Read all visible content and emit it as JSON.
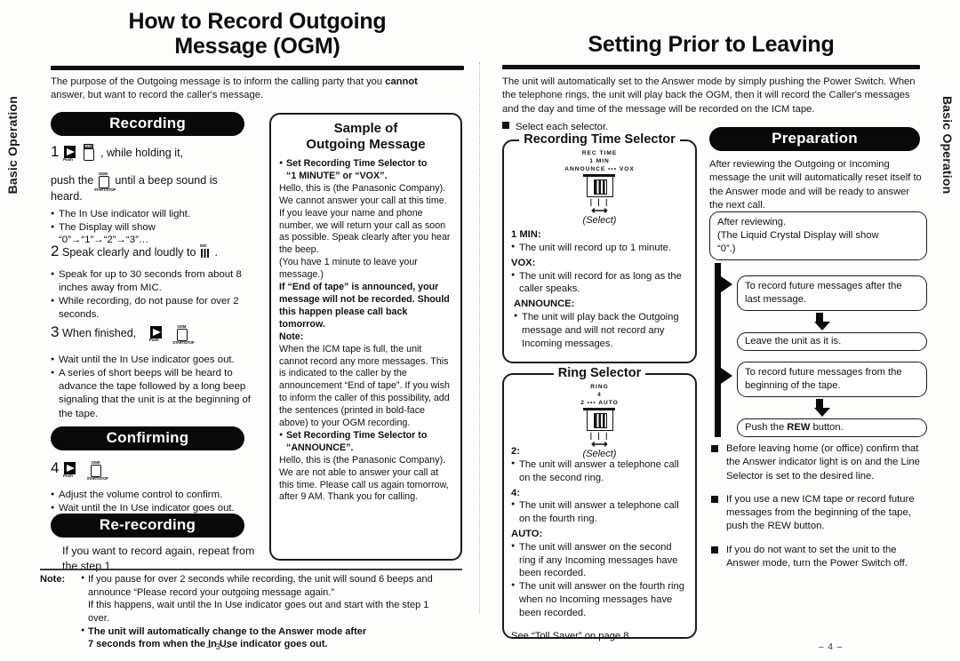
{
  "sidetabs": {
    "left": "Basic Operation",
    "right": "Basic Operation"
  },
  "left_page": {
    "title_line1": "How to Record Outgoing",
    "title_line2": "Message (OGM)",
    "intro_a": "The purpose of the Outgoing message is to inform the calling party that you ",
    "intro_b": "cannot",
    "intro_c": "answer, but want to record the caller's message.",
    "section_recording": "Recording",
    "section_confirming": "Confirming",
    "section_rerecording": "Re-recording",
    "step1": {
      "num": "1",
      "icon_push": "Push",
      "icon_rec": "REC",
      "text_a": ", while holding it,",
      "text_b": "push the",
      "icon_ogm": "OGM",
      "icon_startstop": "START/STOP",
      "text_c": "until a beep sound is",
      "text_d": "heard.",
      "bullets": [
        "The In Use indicator will light.",
        "The Display will show",
        "“0”→“1”→“2”→“3”…"
      ]
    },
    "step2": {
      "num": "2",
      "text_a": "Speak clearly and loudly to",
      "icon_mic": "MIC",
      "text_b": ".",
      "bullets": [
        "Speak for up to 30 seconds from about 8 inches away from MIC.",
        "While recording, do not pause for over 2 seconds."
      ]
    },
    "step3": {
      "num": "3",
      "text_a": "When finished,",
      "icon_push": "Push",
      "icon_ogm": "OGM",
      "icon_startstop": "START/STOP",
      "bullets": [
        "Wait until the In Use indicator goes out.",
        "A series of short beeps will be heard to advance the tape followed by a long beep signaling that the unit is at the beginning of the tape."
      ]
    },
    "step4": {
      "num": "4",
      "icon_push": "Push",
      "icon_ogm": "OGM",
      "icon_startstop": "START/STOP",
      "bullets": [
        "Adjust the volume control to confirm.",
        "Wait until the In Use indicator goes out."
      ]
    },
    "rerecording_text": "If you want to record again, repeat from the step 1.",
    "note": {
      "label": "Note:",
      "item1_line1": "If you pause for over 2 seconds while recording, the unit will sound 6 beeps and",
      "item1_line2": "announce “Please record your outgoing message again.”",
      "item1_line3": "If this happens, wait until the In Use indicator goes out and start with the step 1",
      "item1_line4": "over.",
      "item2_line1": "The unit will automatically change to the Answer mode after",
      "item2_line2": "7 seconds from when the In Use indicator goes out."
    },
    "page_number": "– 3 –",
    "sample_box": {
      "title_line1": "Sample of",
      "title_line2": "Outgoing Message",
      "b1_head_line1": "Set Recording Time Selector to",
      "b1_head_line2": "“1 MINUTE” or “VOX”.",
      "b1_body": "Hello, this is (the Panasonic Company). We cannot answer your call at this time. If you leave your name and phone number, we will return your call as soon as possible. Speak clearly after you hear the beep.",
      "b1_paren": "(You have 1 minute to leave your message.)",
      "b1_bold": "If “End of tape” is announced, your message will not be recorded. Should this happen please call back tomorrow.",
      "note_label": "Note:",
      "note_body": "When the ICM tape is full, the unit cannot record any more messages. This is indicated to the caller by the announcement “End of tape”. If you wish to inform the caller of this possibility, add the sentences (printed in bold-face above) to your OGM recording.",
      "b2_head_line1": "Set Recording Time Selector to",
      "b2_head_line2": "“ANNOUNCE”.",
      "b2_body": "Hello, this is (the Panasonic Company). We are not able to answer your call at this time. Please call us again tomorrow, after 9 AM. Thank you for calling."
    }
  },
  "right_page": {
    "title": "Setting Prior to Leaving",
    "intro": "The unit will automatically set to the Answer mode by simply pushing the Power Switch. When the telephone rings, the unit will play back the OGM, then it will record the Caller's messages and the day and time of the message will be recorded on the ICM tape.",
    "select_label": "Select each selector.",
    "rec_time_selector": {
      "title": "Recording Time Selector",
      "switch_line1": "REC TIME",
      "switch_line2": "1 MIN",
      "switch_line3": "ANNOUNCE ••• VOX",
      "switch_ticks": "❘❘❘",
      "select_caption": "(Select)",
      "entries": [
        {
          "head": "1 MIN:",
          "bullets": [
            "The unit will record up to 1 minute."
          ]
        },
        {
          "head": "VOX:",
          "bullets": [
            "The unit will record for as long as the caller speaks."
          ]
        },
        {
          "head": "ANNOUNCE:",
          "bullets": [
            "The unit will play back the Outgoing message and will not record any Incoming messages."
          ]
        }
      ]
    },
    "ring_selector": {
      "title": "Ring Selector",
      "switch_line1": "RING",
      "switch_line2": "4",
      "switch_line3": "2 ••• AUTO",
      "switch_ticks": "❘❘❘",
      "select_caption": "(Select)",
      "entries": [
        {
          "head": "2:",
          "bullets": [
            "The unit will answer a telephone call on the second ring."
          ]
        },
        {
          "head": "4:",
          "bullets": [
            "The unit will answer a telephone call on the fourth ring."
          ]
        },
        {
          "head": "AUTO:",
          "bullets": [
            "The unit will answer on the second ring if any Incoming messages have been recorded.",
            "The unit will answer on the fourth ring when no Incoming messages have been recorded."
          ]
        }
      ],
      "footer": "See “Toll Saver” on page  8."
    },
    "preparation": {
      "title": "Preparation",
      "intro": "After reviewing the Outgoing or Incoming message the unit will automatically reset itself to the Answer mode and will be ready to answer the next call.",
      "flow": {
        "box1_line1": "After reviewing.",
        "box1_line2": "(The Liquid Crystal Display will show",
        "box1_line3": "“0”.)",
        "box2": "To record future messages after the last message.",
        "box3": "Leave the unit as it is.",
        "box4": "To record future messages from the beginning of the tape.",
        "box5_a": "Push the ",
        "box5_b": "REW",
        "box5_c": " button."
      },
      "squares": [
        "Before leaving home (or office) confirm that the Answer indicator light is on and the Line Selector is set to the desired line.",
        "If you use a new ICM tape or record future messages from the beginning of the tape, push the REW button.",
        "If you do not want to set the unit to the Answer mode, turn the Power Switch off."
      ]
    },
    "page_number": "– 4 –"
  }
}
